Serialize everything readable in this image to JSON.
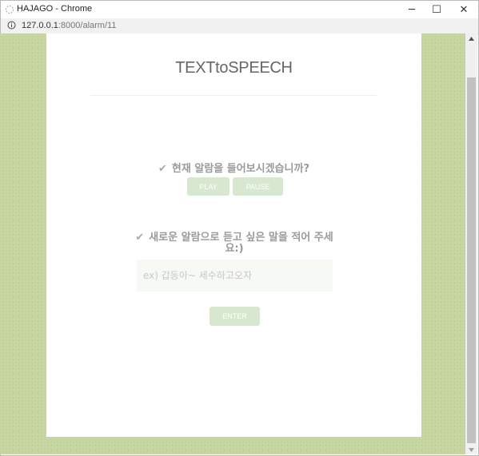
{
  "window": {
    "title": "HAJAGO - Chrome",
    "minimize_icon": "─",
    "maximize_icon": "☐",
    "close_icon": "✕"
  },
  "address": {
    "url_host": "127.0.0.1",
    "url_rest": ":8000/alarm/11"
  },
  "page": {
    "heading": "TEXTtoSPEECH",
    "question1": "현재 알람을 들어보시겠습니까?",
    "play_label": "PLAY",
    "pause_label": "PAUSE",
    "question2": "새로운 알람으로 듣고 싶은 말을 적어 주세요:)",
    "input_placeholder": "ex) 갑동아~ 세수하고오자",
    "enter_label": "ENTER",
    "check_glyph": "✔"
  },
  "colors": {
    "background_green": "#c6d5a0",
    "button_green": "#d8e8d0",
    "text_gray": "#9a9a9a"
  }
}
